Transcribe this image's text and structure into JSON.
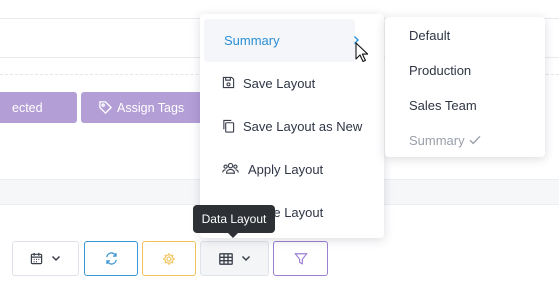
{
  "background": {
    "selected_label": "ected",
    "assign_tags_label": "Assign Tags"
  },
  "layout_menu": {
    "items": [
      {
        "label": "Summary",
        "icon": "chevron-right-icon",
        "active": true
      },
      {
        "label": "Save Layout",
        "icon": "save-icon"
      },
      {
        "label": "Save Layout as New",
        "icon": "copy-icon"
      },
      {
        "label": "Apply Layout",
        "icon": "users-icon"
      },
      {
        "label": "Delete Layout",
        "icon": "trash-icon"
      }
    ]
  },
  "layout_submenu": {
    "items": [
      {
        "label": "Default"
      },
      {
        "label": "Production"
      },
      {
        "label": "Sales Team"
      },
      {
        "label": "Summary",
        "checked": true,
        "disabled": true
      }
    ]
  },
  "tooltip": {
    "text": "Data Layout"
  },
  "toolbar": {
    "buttons": [
      {
        "name": "date-picker",
        "icon": "calendar-icon"
      },
      {
        "name": "refresh",
        "icon": "refresh-icon"
      },
      {
        "name": "settings",
        "icon": "gear-icon"
      },
      {
        "name": "data-layout",
        "icon": "table-icon"
      },
      {
        "name": "filter",
        "icon": "filter-icon"
      }
    ]
  },
  "colors": {
    "accent_blue": "#2b8fd6",
    "purple": "#b39ed6",
    "refresh_border": "#3a97d4",
    "settings_border": "#f2c35a",
    "filter_border": "#9c7fd3",
    "tooltip_bg": "#2d3035"
  }
}
